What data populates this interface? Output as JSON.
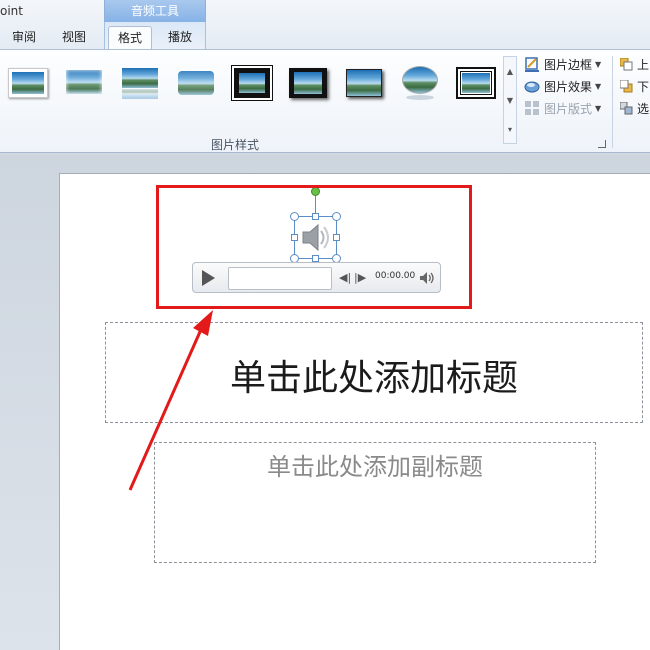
{
  "app": {
    "title_fragment": "oint"
  },
  "context_tab_group": {
    "label": "音频工具"
  },
  "tabs": [
    {
      "label": "审阅"
    },
    {
      "label": "视图"
    },
    {
      "label": "格式",
      "active": true
    },
    {
      "label": "播放"
    }
  ],
  "ribbon": {
    "picture_styles": {
      "group_label": "图片样式",
      "gallery_items": [
        "simple-frame-white",
        "soft-edge",
        "reflected",
        "soft-edge-oval",
        "thick-black-frame",
        "black-shadow-frame",
        "drop-shadow",
        "oval-reflection",
        "double-frame-black"
      ]
    },
    "commands": {
      "border": "图片边框",
      "effects": "图片效果",
      "layout": "图片版式"
    },
    "arrange": {
      "forward": "上",
      "backward": "下",
      "selection": "选"
    }
  },
  "player": {
    "time": "00:00.00"
  },
  "slide": {
    "title_placeholder": "单击此处添加标题",
    "subtitle_placeholder": "单击此处添加副标题"
  },
  "colors": {
    "highlight_frame": "#e21a1a",
    "accent": "#86b2e6"
  },
  "icons": [
    "play-icon",
    "step-back-icon",
    "step-forward-icon",
    "volume-icon",
    "speaker-icon",
    "border-icon",
    "effects-icon",
    "layout-icon",
    "dialog-launcher-icon"
  ]
}
